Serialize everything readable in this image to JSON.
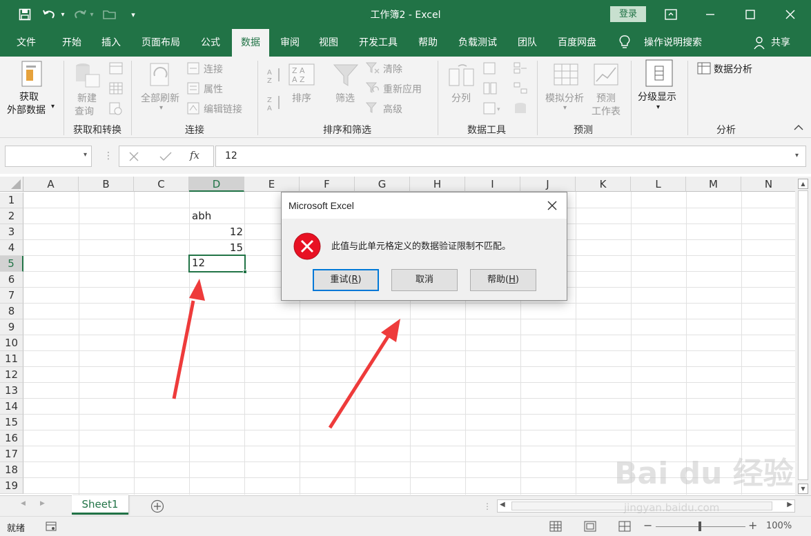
{
  "window": {
    "title": "工作簿2  -  Excel",
    "login_label": "登录"
  },
  "tabs": [
    "文件",
    "开始",
    "插入",
    "页面布局",
    "公式",
    "数据",
    "审阅",
    "视图",
    "开发工具",
    "帮助",
    "负载测试",
    "团队",
    "百度网盘"
  ],
  "active_tab": "数据",
  "tell_me": "操作说明搜索",
  "share": "共享",
  "ribbon": {
    "get_data_line1": "获取",
    "get_data_line2": "外部数据",
    "new_query_line1": "新建",
    "new_query_line2": "查询",
    "group_get_transform": "获取和转换",
    "refresh_all": "全部刷新",
    "connections": "连接",
    "properties": "属性",
    "edit_links": "编辑链接",
    "group_connections": "连接",
    "sort": "排序",
    "filter": "筛选",
    "clear": "清除",
    "reapply": "重新应用",
    "advanced": "高级",
    "group_sort_filter": "排序和筛选",
    "text_to_columns": "分列",
    "group_data_tools": "数据工具",
    "what_if_analysis": "模拟分析",
    "forecast_sheet_line1": "预测",
    "forecast_sheet_line2": "工作表",
    "group_forecast": "预测",
    "outline": "分级显示",
    "data_analysis": "数据分析",
    "group_analysis": "分析"
  },
  "formula_bar": {
    "name_box": "",
    "value": "12",
    "fx": "fx"
  },
  "columns": [
    "A",
    "B",
    "C",
    "D",
    "E",
    "F",
    "G",
    "H",
    "I",
    "J",
    "K",
    "L",
    "M",
    "N"
  ],
  "rows": [
    "1",
    "2",
    "3",
    "4",
    "5",
    "6",
    "7",
    "8",
    "9",
    "10",
    "11",
    "12",
    "13",
    "14",
    "15",
    "16",
    "17",
    "18",
    "19"
  ],
  "selected_column": "D",
  "selected_row": "5",
  "cells": {
    "D2": "abh",
    "D3": "12",
    "D4": "15",
    "D5": "12"
  },
  "sheet_tab": "Sheet1",
  "status": {
    "ready": "就绪",
    "zoom": "100%"
  },
  "dialog": {
    "title": "Microsoft Excel",
    "message": "此值与此单元格定义的数据验证限制不匹配。",
    "retry_label": "重试(",
    "retry_key": "R",
    "retry_end": ")",
    "cancel_label": "取消",
    "help_label": "帮助(",
    "help_key": "H",
    "help_end": ")"
  },
  "watermark": {
    "brand": "Bai du 经验",
    "url": "jingyan.baidu.com"
  },
  "colors": {
    "excel_green": "#217346",
    "error_red": "#e81123",
    "arrow_red": "#ee3b3b"
  }
}
